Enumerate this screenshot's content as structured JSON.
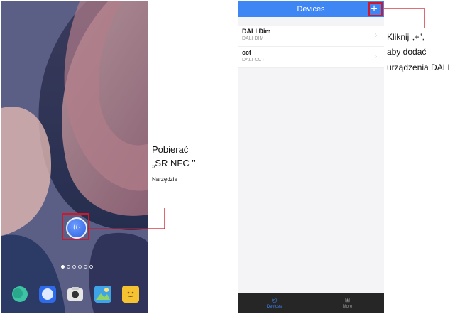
{
  "colors": {
    "accent": "#3f86f5",
    "highlight": "#d0182a",
    "nav_bg": "#262626"
  },
  "home_screen": {
    "nfc_app_icon": "nfc-app-icon",
    "page_dots": 6,
    "active_dot": 0,
    "dock_icons": [
      "messages-icon",
      "browser-icon",
      "camera-icon",
      "gallery-icon",
      "notes-icon"
    ]
  },
  "callouts": {
    "left": {
      "line1": "Pobierać",
      "line2": "„SR NFC ”",
      "line3": "Narzędzie"
    },
    "right": {
      "line1": "Kliknij „+”,",
      "line2": "aby dodać",
      "line3": "urządzenia DALI"
    }
  },
  "app": {
    "title": "Devices",
    "add_label": "+",
    "devices": [
      {
        "name": "DALI Dim",
        "type": "DALI DIM"
      },
      {
        "name": "cct",
        "type": "DALI CCT"
      }
    ],
    "bottom_nav": [
      {
        "label": "Devices",
        "icon": "devices-icon",
        "active": true
      },
      {
        "label": "More",
        "icon": "grid-icon",
        "active": false
      }
    ]
  }
}
